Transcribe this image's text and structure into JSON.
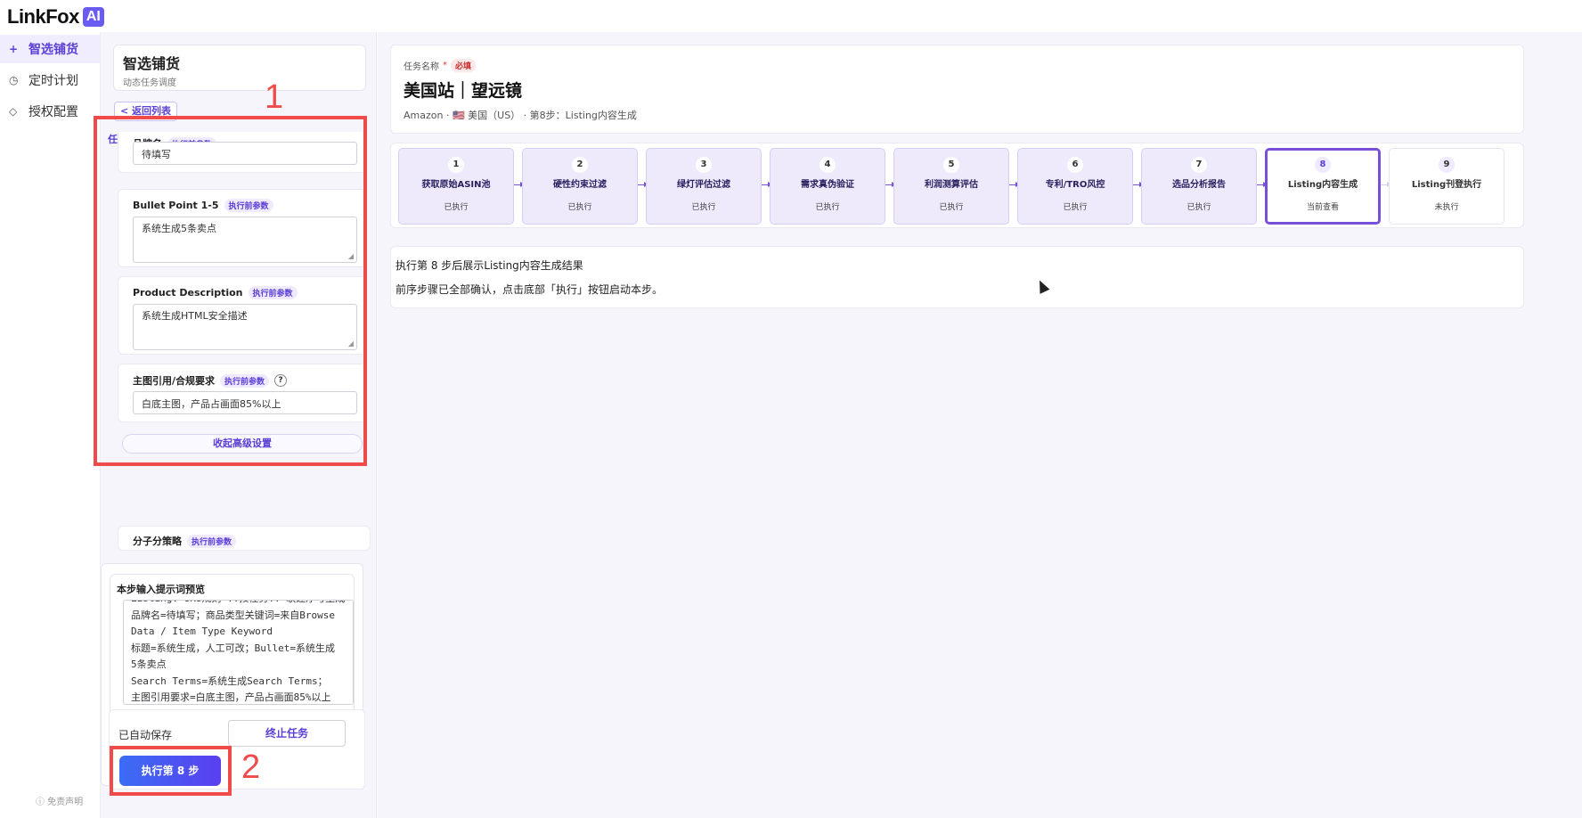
{
  "app": {
    "logo_text": "LinkFox",
    "logo_badge": "AI"
  },
  "nav": {
    "items": [
      {
        "icon": "+",
        "label": "智选铺货"
      },
      {
        "icon": "◷",
        "label": "定时计划"
      },
      {
        "icon": "◇",
        "label": "授权配置"
      }
    ],
    "disclaimer": "ⓘ 免责声明"
  },
  "panel": {
    "title": "智选铺货",
    "subtitle": "动态任务调度",
    "back_label": "< 返回列表",
    "params_title": "任务步骤参数",
    "partial_top_label": "品牌名",
    "tag_label": "执行前参数",
    "brand_value": "待填写",
    "bullet": {
      "label": "Bullet Point 1-5",
      "value": "系统生成5条卖点"
    },
    "description": {
      "label": "Product Description",
      "value": "系统生成HTML安全描述"
    },
    "main_image": {
      "label": "主图引用/合规要求",
      "help": "?",
      "value": "白底主图，产品占画面85%以上"
    },
    "collapse_label": "收起高级设置",
    "partial_bottom_label": "分子分策略",
    "preview_title": "本步输入提示词预览",
    "preview_lines": [
      "Listing: UKU规则 ..按任务.. 联建序号生成",
      "品牌名=待填写；商品类型关键词=来自Browse",
      "Data / Item Type Keyword",
      "标题=系统生成，人工可改；Bullet=系统生成",
      "5条卖点",
      "Search Terms=系统生成Search Terms；",
      "主图引用要求=白底主图，产品占画面85%以上"
    ],
    "autosave": "已自动保存",
    "stop_label": "终止任务",
    "run_label": "执行第 8 步",
    "annot_1": "1",
    "annot_2": "2"
  },
  "task": {
    "label": "任务名称",
    "required_mark": "*",
    "required_tag": "必填",
    "name": "美国站｜望远镜",
    "meta": "Amazon · 🇺🇸 美国（US） · 第8步：Listing内容生成"
  },
  "steps": [
    {
      "num": "1",
      "label": "获取原始ASIN池",
      "status": "已执行"
    },
    {
      "num": "2",
      "label": "硬性约束过滤",
      "status": "已执行"
    },
    {
      "num": "3",
      "label": "绿灯评估过滤",
      "status": "已执行"
    },
    {
      "num": "4",
      "label": "需求真伪验证",
      "status": "已执行"
    },
    {
      "num": "5",
      "label": "利润测算评估",
      "status": "已执行"
    },
    {
      "num": "6",
      "label": "专利/TRO风控",
      "status": "已执行"
    },
    {
      "num": "7",
      "label": "选品分析报告",
      "status": "已执行"
    },
    {
      "num": "8",
      "label": "Listing内容生成",
      "status": "当前查看"
    },
    {
      "num": "9",
      "label": "Listing刊登执行",
      "status": "未执行"
    }
  ],
  "result": {
    "line1": "执行第 8 步后展示Listing内容生成结果",
    "line2": "前序步骤已全部确认，点击底部「执行」按钮启动本步。"
  },
  "colors": {
    "accent": "#5b3fd6",
    "annotation": "#ef4b4b",
    "step_done_bg": "#eeeafc"
  }
}
